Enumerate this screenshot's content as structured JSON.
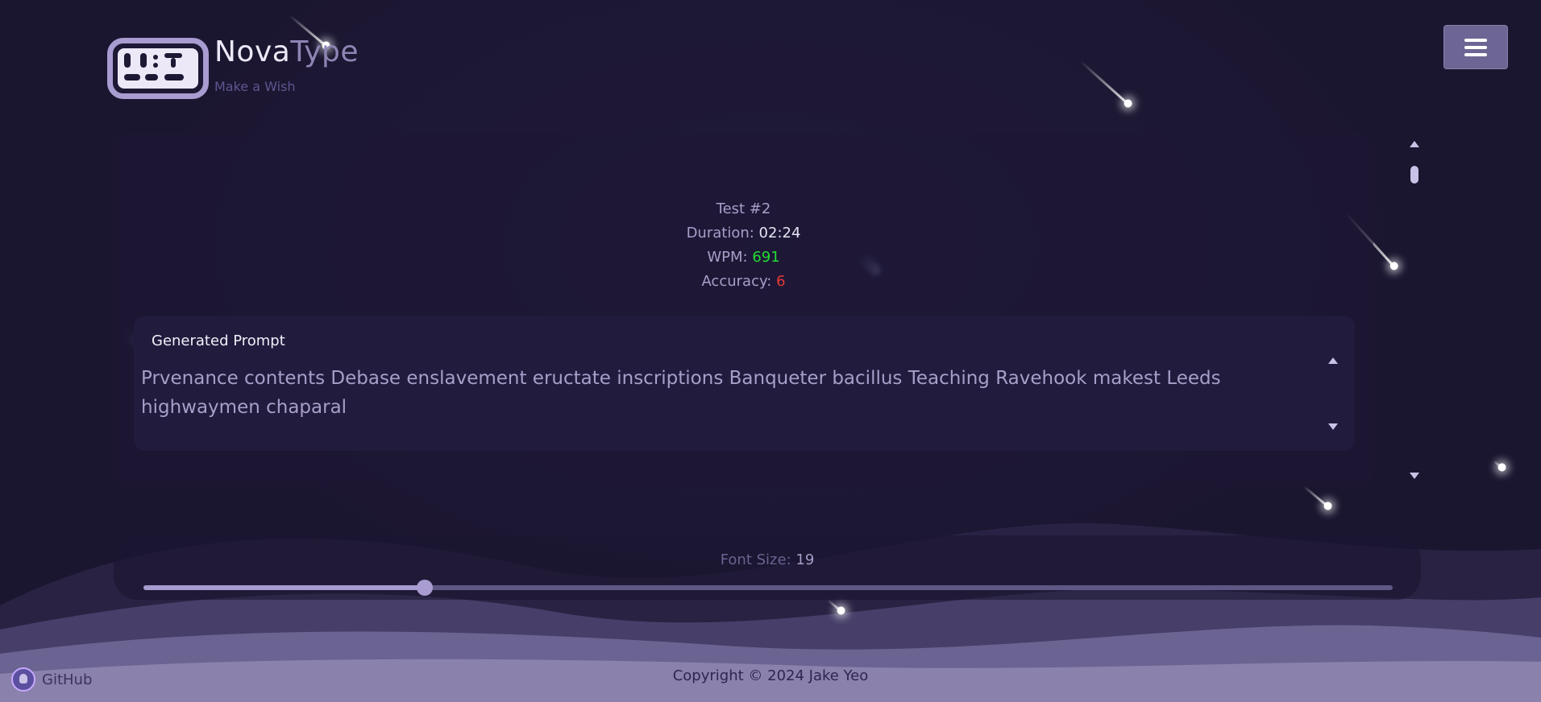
{
  "app": {
    "name_part1": "Nova",
    "name_part2": "Type",
    "tagline": "Make a Wish"
  },
  "header": {
    "menu_icon": "hamburger-menu-icon"
  },
  "test": {
    "title": "Test #2",
    "duration_label": "Duration:",
    "duration_value": "02:24",
    "wpm_label": "WPM:",
    "wpm_value": "691",
    "accuracy_label": "Accuracy:",
    "accuracy_value": "6"
  },
  "prompt": {
    "title": "Generated Prompt",
    "text": "Prvenance contents Debase enslavement eructate inscriptions Banqueter bacillus Teaching Ravehook makest Leeds highwaymen chaparal"
  },
  "font_size": {
    "label": "Font Size:",
    "value": "19",
    "slider_fraction": 0.225
  },
  "footer": {
    "github_label": "GitHub",
    "copyright": "Copyright © 2024 Jake Yeo"
  },
  "colors": {
    "background": "#1b1630",
    "accent": "#a89cd0",
    "wpm": "#22dd33",
    "accuracy": "#e53935"
  }
}
